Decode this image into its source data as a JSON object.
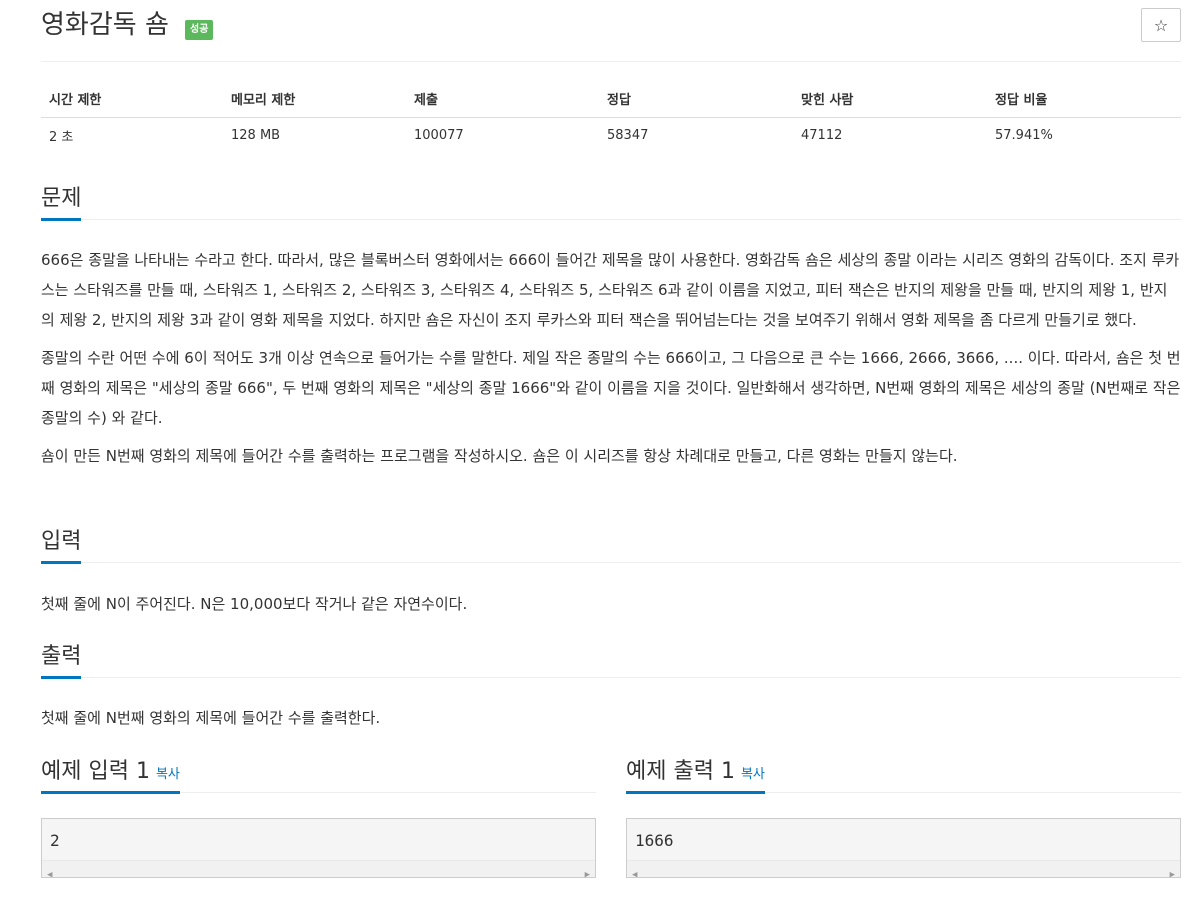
{
  "problem": {
    "title": "영화감독 숌",
    "badge": "성공",
    "star_icon": "☆"
  },
  "info_table": {
    "headers": [
      "시간 제한",
      "메모리 제한",
      "제출",
      "정답",
      "맞힌 사람",
      "정답 비율"
    ],
    "values": [
      "2 초",
      "128 MB",
      "100077",
      "58347",
      "47112",
      "57.941%"
    ]
  },
  "sections": {
    "description": {
      "heading": "문제",
      "paragraphs": [
        "666은 종말을 나타내는 수라고 한다. 따라서, 많은 블록버스터 영화에서는 666이 들어간 제목을 많이 사용한다. 영화감독 숌은 세상의 종말 이라는 시리즈 영화의 감독이다. 조지 루카스는 스타워즈를 만들 때, 스타워즈 1, 스타워즈 2, 스타워즈 3, 스타워즈 4, 스타워즈 5, 스타워즈 6과 같이 이름을 지었고, 피터 잭슨은 반지의 제왕을 만들 때, 반지의 제왕 1, 반지의 제왕 2, 반지의 제왕 3과 같이 영화 제목을 지었다. 하지만 숌은 자신이 조지 루카스와 피터 잭슨을 뛰어넘는다는 것을 보여주기 위해서 영화 제목을 좀 다르게 만들기로 했다.",
        "종말의 수란 어떤 수에 6이 적어도 3개 이상 연속으로 들어가는 수를 말한다. 제일 작은 종말의 수는 666이고, 그 다음으로 큰 수는 1666, 2666, 3666, .... 이다. 따라서, 숌은 첫 번째 영화의 제목은 \"세상의 종말 666\", 두 번째 영화의 제목은 \"세상의 종말 1666\"와 같이 이름을 지을 것이다. 일반화해서 생각하면, N번째 영화의 제목은 세상의 종말 (N번째로 작은 종말의 수) 와 같다.",
        "숌이 만든 N번째 영화의 제목에 들어간 수를 출력하는 프로그램을 작성하시오. 숌은 이 시리즈를 항상 차례대로 만들고, 다른 영화는 만들지 않는다."
      ]
    },
    "input": {
      "heading": "입력",
      "text": "첫째 줄에 N이 주어진다. N은 10,000보다 작거나 같은 자연수이다."
    },
    "output": {
      "heading": "출력",
      "text": "첫째 줄에 N번째 영화의 제목에 들어간 수를 출력한다."
    }
  },
  "samples": {
    "input": {
      "heading": "예제 입력 1",
      "copy_label": "복사",
      "content": "2"
    },
    "output": {
      "heading": "예제 출력 1",
      "copy_label": "복사",
      "content": "1666"
    }
  },
  "colors": {
    "accent": "#0076c0",
    "success_badge": "#5cb85c"
  }
}
